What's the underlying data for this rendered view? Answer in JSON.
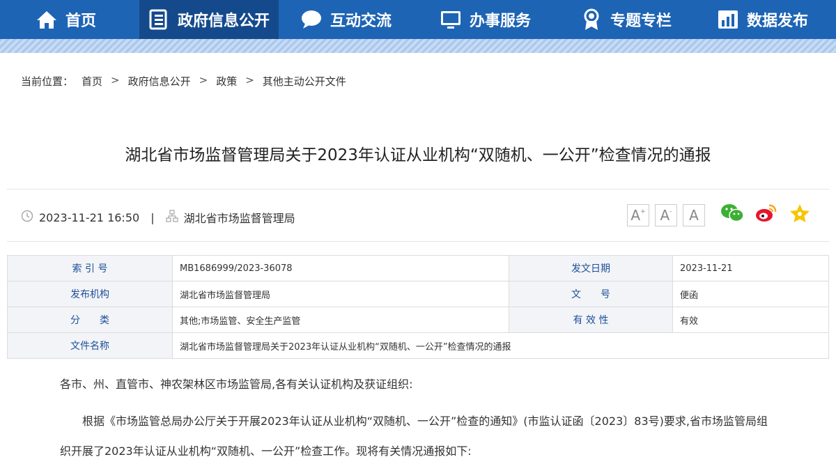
{
  "nav": {
    "items": [
      {
        "label": "首页",
        "icon": "home-icon"
      },
      {
        "label": "政府信息公开",
        "icon": "document-list-icon",
        "active": true
      },
      {
        "label": "互动交流",
        "icon": "chat-bubble-icon"
      },
      {
        "label": "办事服务",
        "icon": "monitor-icon"
      },
      {
        "label": "专题专栏",
        "icon": "award-badge-icon"
      },
      {
        "label": "数据发布",
        "icon": "bar-chart-icon"
      }
    ],
    "bg_color": "#1e64b4",
    "active_color": "#144a8c"
  },
  "breadcrumb": {
    "prefix": "当前位置：",
    "items": [
      "首页",
      "政府信息公开",
      "政策",
      "其他主动公开文件"
    ],
    "separator": ">"
  },
  "article": {
    "title": "湖北省市场监督管理局关于2023年认证从业机构“双随机、一公开”检查情况的通报",
    "date": "2023-11-21 16:50",
    "meta_sep": "|",
    "source": "湖北省市场监督管理局"
  },
  "tools": {
    "font_increase": "A",
    "font_decrease": "A",
    "font_reset": "A",
    "share_icons": [
      "wechat-icon",
      "weibo-icon",
      "favorite-star-icon"
    ]
  },
  "info_table": {
    "rows": [
      {
        "label1": "索 引 号",
        "value1": "MB1686999/2023-36078",
        "label2": "发文日期",
        "value2": "2023-11-21"
      },
      {
        "label1": "发布机构",
        "value1": "湖北省市场监督管理局",
        "label2": "文　　号",
        "value2": "便函"
      },
      {
        "label1": "分　　类",
        "value1": "其他;市场监管、安全生产监管",
        "label2": "有 效 性",
        "value2": "有效"
      },
      {
        "label1": "文件名称",
        "value1": "湖北省市场监督管理局关于2023年认证从业机构“双随机、一公开”检查情况的通报"
      }
    ]
  },
  "body": {
    "salutation": "各市、州、直管市、神农架林区市场监管局,各有关认证机构及获证组织:",
    "para1_line1": "根据《市场监管总局办公厅关于开展2023年认证从业机构“双随机、一公开”检查的通知》(市监认证函〔2023〕83号)要求,省市场监管局组",
    "para1_line2": "织开展了2023年认证从业机构“双随机、一公开”检查工作。现将有关情况通报如下:"
  }
}
